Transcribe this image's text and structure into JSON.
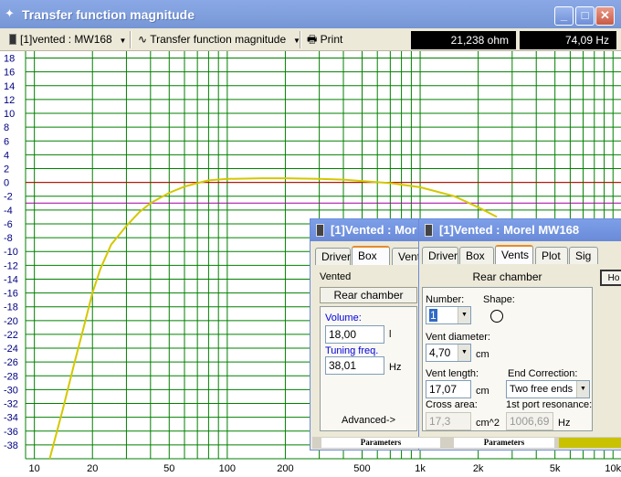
{
  "window": {
    "title": "Transfer function magnitude",
    "btn_minimize": "_",
    "btn_maximize": "□",
    "btn_close": "✕"
  },
  "toolbar": {
    "project_dropdown": "[1]vented : MW168",
    "view_dropdown": "Transfer function magnitude",
    "print_label": "Print",
    "readout_impedance": "21,238 ohm",
    "readout_frequency": "74,09 Hz"
  },
  "chart_data": {
    "type": "line",
    "y_ticks": [
      "18",
      "16",
      "14",
      "12",
      "10",
      "8",
      "6",
      "4",
      "2",
      "0",
      "-2",
      "-4",
      "-6",
      "-8",
      "-10",
      "-12",
      "-14",
      "-16",
      "-18",
      "-20",
      "-22",
      "-24",
      "-26",
      "-28",
      "-30",
      "-32",
      "-34",
      "-36",
      "-38"
    ],
    "x_ticks": [
      "10",
      "20",
      "50",
      "100",
      "200",
      "500",
      "1k",
      "2k",
      "5k",
      "10k"
    ],
    "ylim": [
      -40,
      19
    ],
    "xlim_hz": [
      9,
      11000
    ],
    "x_scale": "log",
    "series": [
      {
        "color": "#d4c800",
        "points": [
          [
            12,
            -40
          ],
          [
            14,
            -33
          ],
          [
            16,
            -26.5
          ],
          [
            18,
            -21
          ],
          [
            20,
            -16
          ],
          [
            22,
            -12.5
          ],
          [
            25,
            -9
          ],
          [
            30,
            -6.3
          ],
          [
            35,
            -4.3
          ],
          [
            40,
            -3
          ],
          [
            50,
            -1.5
          ],
          [
            60,
            -0.6
          ],
          [
            70,
            -0.1
          ],
          [
            80,
            0.3
          ],
          [
            100,
            0.5
          ],
          [
            150,
            0.6
          ],
          [
            200,
            0.6
          ],
          [
            300,
            0.5
          ],
          [
            400,
            0.4
          ],
          [
            500,
            0.2
          ],
          [
            700,
            -0.1
          ],
          [
            1000,
            -0.7
          ],
          [
            1500,
            -2
          ],
          [
            2000,
            -3.6
          ],
          [
            2500,
            -5
          ]
        ]
      }
    ],
    "ref_lines": {
      "red": 0,
      "magenta": -3
    },
    "grid": true
  },
  "dialog_back": {
    "title": "[1]Vented : Mor",
    "tabs": [
      "Driver",
      "Box",
      "Vents"
    ],
    "active_tab": "Box",
    "section": "Vented",
    "rear_chamber_button": "Rear chamber",
    "volume_label": "Volume:",
    "volume_value": "18,00",
    "volume_unit": "l",
    "tuning_label": "Tuning freq.",
    "tuning_value": "38,01",
    "tuning_unit": "Hz",
    "advanced_label": "Advanced->"
  },
  "dialog_front": {
    "title": "[1]Vented : Morel MW168",
    "tabs": [
      "Driver",
      "Box",
      "Vents",
      "Plot",
      "Sig"
    ],
    "active_tab": "Vents",
    "rear_chamber_label": "Rear chamber",
    "side_button": "Ho",
    "number_label": "Number:",
    "number_value": "1",
    "shape_label": "Shape:",
    "vent_diameter_label": "Vent diameter:",
    "vent_diameter_value": "4,70",
    "vent_diameter_unit": "cm",
    "vent_length_label": "Vent length:",
    "vent_length_value": "17,07",
    "vent_length_unit": "cm",
    "end_correction_label": "End Correction:",
    "end_correction_value": "Two free ends",
    "cross_area_label": "Cross area:",
    "cross_area_value": "17,3",
    "cross_area_unit": "cm^2",
    "port_resonance_label": "1st port resonance:",
    "port_resonance_value": "1006,69",
    "port_resonance_unit": "Hz"
  },
  "statusbar": {
    "tab1": "Parameters",
    "tab2": "Parameters"
  }
}
